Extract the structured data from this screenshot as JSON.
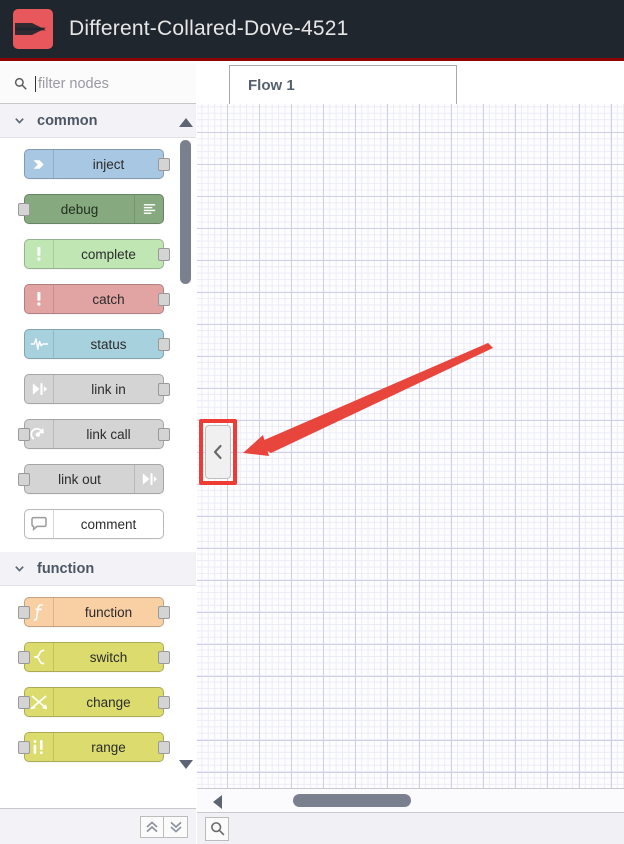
{
  "header": {
    "title": "Different-Collared-Dove-4521",
    "logo_icon": "node-red-logo-icon",
    "bg_color": "#20262e",
    "accent_color": "#8f0000"
  },
  "palette": {
    "search": {
      "placeholder": "filter nodes",
      "value": "",
      "icon": "search-icon"
    },
    "categories": [
      {
        "label": "common",
        "expanded": true,
        "chevron_icon": "chevron-down-icon",
        "nodes": [
          {
            "label": "inject",
            "icon": "inject-arrow-icon",
            "color": "#a7c7e2",
            "icon_side": "left",
            "ports": [
              "out"
            ]
          },
          {
            "label": "debug",
            "icon": "debug-lines-icon",
            "color": "#87a980",
            "icon_side": "right",
            "ports": [
              "in"
            ]
          },
          {
            "label": "complete",
            "icon": "exclamation-icon",
            "color": "#c0e6b4",
            "icon_side": "left",
            "ports": [
              "out"
            ]
          },
          {
            "label": "catch",
            "icon": "exclamation-icon",
            "color": "#e2a3a3",
            "icon_side": "left",
            "ports": [
              "out"
            ]
          },
          {
            "label": "status",
            "icon": "pulse-wave-icon",
            "color": "#a8d1de",
            "icon_side": "left",
            "ports": [
              "out"
            ]
          },
          {
            "label": "link in",
            "icon": "link-icon",
            "color": "#d4d4d4",
            "icon_side": "left",
            "ports": [
              "out"
            ]
          },
          {
            "label": "link call",
            "icon": "link-call-icon",
            "color": "#d4d4d4",
            "icon_side": "left",
            "ports": [
              "in",
              "out"
            ]
          },
          {
            "label": "link out",
            "icon": "link-icon",
            "color": "#d4d4d4",
            "icon_side": "right",
            "ports": [
              "in"
            ]
          },
          {
            "label": "comment",
            "icon": "comment-bubble-icon",
            "color": "#ffffff",
            "icon_side": "left",
            "ports": []
          }
        ]
      },
      {
        "label": "function",
        "expanded": true,
        "chevron_icon": "chevron-down-icon",
        "nodes": [
          {
            "label": "function",
            "icon": "function-f-icon",
            "color": "#f9cfa4",
            "icon_side": "left",
            "ports": [
              "in",
              "out"
            ]
          },
          {
            "label": "switch",
            "icon": "switch-icon",
            "color": "#dcdc6e",
            "icon_side": "left",
            "ports": [
              "in",
              "out"
            ]
          },
          {
            "label": "change",
            "icon": "change-arrows-icon",
            "color": "#dcdc6e",
            "icon_side": "left",
            "ports": [
              "in",
              "out"
            ]
          },
          {
            "label": "range",
            "icon": "range-bars-icon",
            "color": "#dcdc6e",
            "icon_side": "left",
            "ports": [
              "in",
              "out"
            ]
          }
        ]
      }
    ],
    "scrollbar": {
      "up_icon": "triangle-up-icon",
      "down_icon": "triangle-down-icon"
    },
    "footer": {
      "collapse_all_icon": "chevrons-up-icon",
      "expand_all_icon": "chevrons-down-icon"
    }
  },
  "workspace": {
    "tabs": [
      {
        "label": "Flow 1",
        "active": true
      }
    ],
    "collapse_handle": {
      "icon": "chevron-left-icon",
      "tooltip": "collapse-palette"
    },
    "annotation": {
      "highlight_color": "#ee3b33",
      "arrow_color": "#e8453c",
      "target": "collapse-palette-handle"
    },
    "horizontal_scrollbar": {
      "left_icon": "triangle-left-icon"
    },
    "footer": {
      "search_flows_icon": "search-icon"
    }
  }
}
